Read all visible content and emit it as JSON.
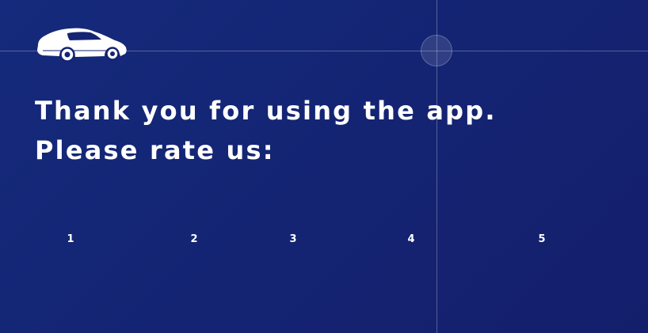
{
  "logo": {
    "icon": "car-icon"
  },
  "prompt": {
    "text": "Thank you for using the app. Please rate us:"
  },
  "rating": {
    "options": [
      "1",
      "2",
      "3",
      "4",
      "5"
    ]
  },
  "colors": {
    "background": "#142473",
    "text": "#ffffff"
  }
}
